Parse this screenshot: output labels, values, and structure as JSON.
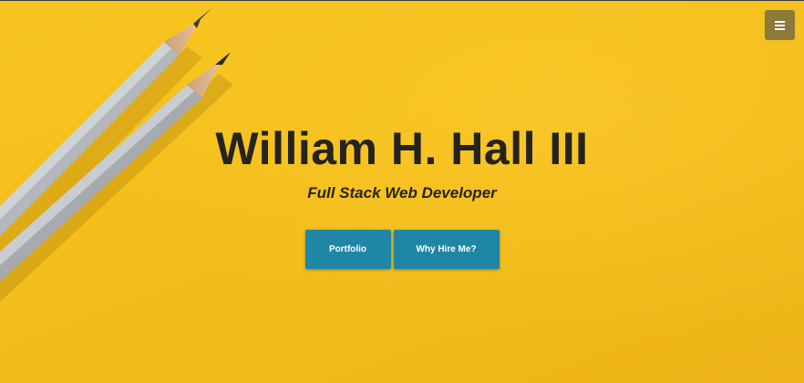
{
  "hero": {
    "name": "William H. Hall III",
    "subtitle": "Full Stack Web Developer"
  },
  "actions": {
    "portfolio_label": "Portfolio",
    "hire_label": "Why Hire Me?"
  },
  "nav": {
    "menu_icon": "hamburger-icon"
  },
  "colors": {
    "background": "#f4c01c",
    "button": "#1f86a6",
    "menu_button": "#8c7a3a",
    "text": "#26231e"
  }
}
